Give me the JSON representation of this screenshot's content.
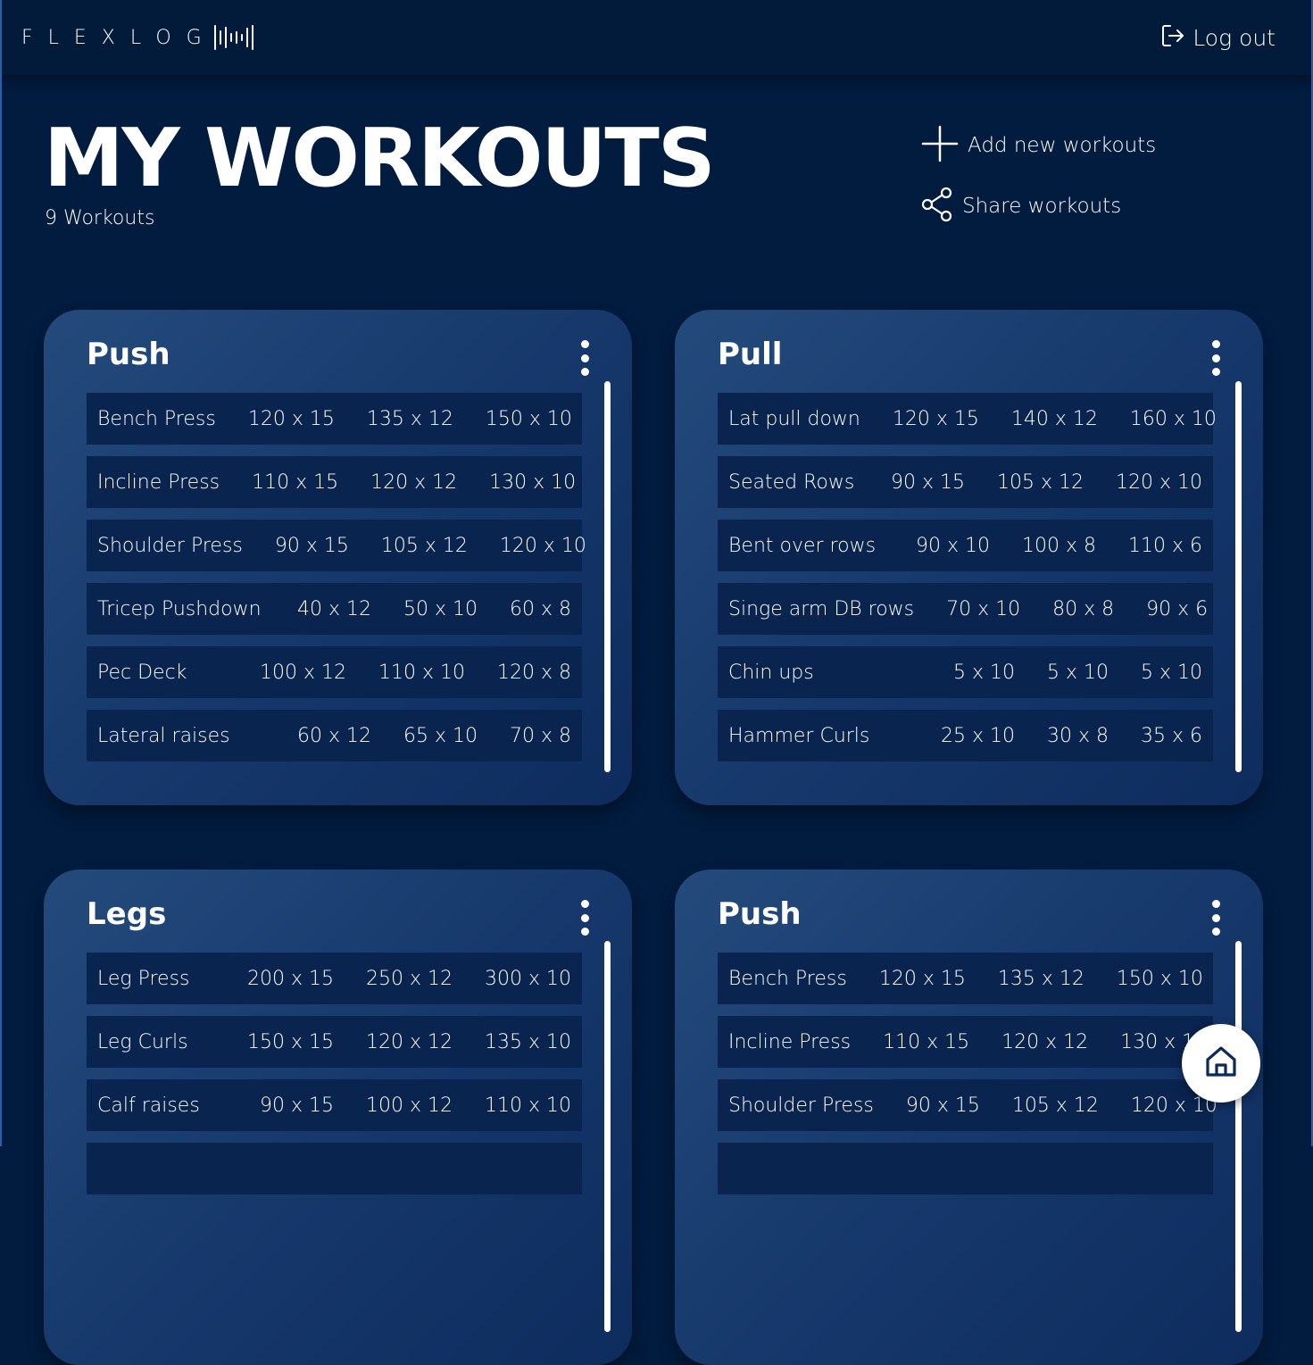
{
  "brand": {
    "logo_text": "FLEXLOG"
  },
  "header": {
    "logout_label": "Log out"
  },
  "page": {
    "title": "MY WORKOUTS",
    "count_label": "9 Workouts"
  },
  "actions": {
    "add_label": "Add new workouts",
    "share_label": "Share workouts"
  },
  "icons": {
    "logo": "sound-wave-icon",
    "logout": "logout-icon",
    "add": "plus-icon",
    "share": "share-icon",
    "menu": "kebab-menu-icon",
    "home": "home-icon"
  },
  "colors": {
    "background": "#021c3f",
    "card": "#1a3f73",
    "row": "#0a2450",
    "text": "#ffffff"
  },
  "workouts": [
    {
      "title": "Push",
      "exercises": [
        {
          "name": "Bench Press",
          "sets": [
            "120 x 15",
            "135 x 12",
            "150 x 10"
          ]
        },
        {
          "name": "Incline Press",
          "sets": [
            "110 x 15",
            "120 x 12",
            "130 x 10"
          ]
        },
        {
          "name": "Shoulder Press",
          "sets": [
            "90 x 15",
            "105 x 12",
            "120 x 10"
          ]
        },
        {
          "name": "Tricep Pushdown",
          "sets": [
            "40 x 12",
            "50 x 10",
            "60 x 8"
          ]
        },
        {
          "name": "Pec Deck",
          "sets": [
            "100 x 12",
            "110 x 10",
            "120 x 8"
          ]
        },
        {
          "name": "Lateral raises",
          "sets": [
            "60 x 12",
            "65 x 10",
            "70 x 8"
          ]
        }
      ]
    },
    {
      "title": "Pull",
      "exercises": [
        {
          "name": "Lat pull down",
          "sets": [
            "120 x 15",
            "140 x 12",
            "160 x 10"
          ]
        },
        {
          "name": "Seated Rows",
          "sets": [
            "90 x 15",
            "105 x 12",
            "120 x 10"
          ]
        },
        {
          "name": "Bent over rows",
          "sets": [
            "90 x 10",
            "100 x 8",
            "110 x 6"
          ]
        },
        {
          "name": "Singe arm DB rows",
          "sets": [
            "70 x 10",
            "80 x 8",
            "90 x 6"
          ]
        },
        {
          "name": "Chin ups",
          "sets": [
            "5 x 10",
            "5 x 10",
            "5 x 10"
          ]
        },
        {
          "name": "Hammer Curls",
          "sets": [
            "25 x 10",
            "30 x 8",
            "35 x 6"
          ]
        }
      ]
    },
    {
      "title": "Legs",
      "exercises": [
        {
          "name": "Leg Press",
          "sets": [
            "200 x 15",
            "250 x 12",
            "300 x 10"
          ]
        },
        {
          "name": "Leg Curls",
          "sets": [
            "150 x 15",
            "120 x 12",
            "135 x 10"
          ]
        },
        {
          "name": "Calf raises",
          "sets": [
            "90 x 15",
            "100 x 12",
            "110 x 10"
          ]
        }
      ]
    },
    {
      "title": "Push",
      "exercises": [
        {
          "name": "Bench Press",
          "sets": [
            "120 x 15",
            "135 x 12",
            "150 x 10"
          ]
        },
        {
          "name": "Incline Press",
          "sets": [
            "110 x 15",
            "120 x 12",
            "130 x 10"
          ]
        },
        {
          "name": "Shoulder Press",
          "sets": [
            "90 x 15",
            "105 x 12",
            "120 x 10"
          ]
        }
      ]
    }
  ]
}
